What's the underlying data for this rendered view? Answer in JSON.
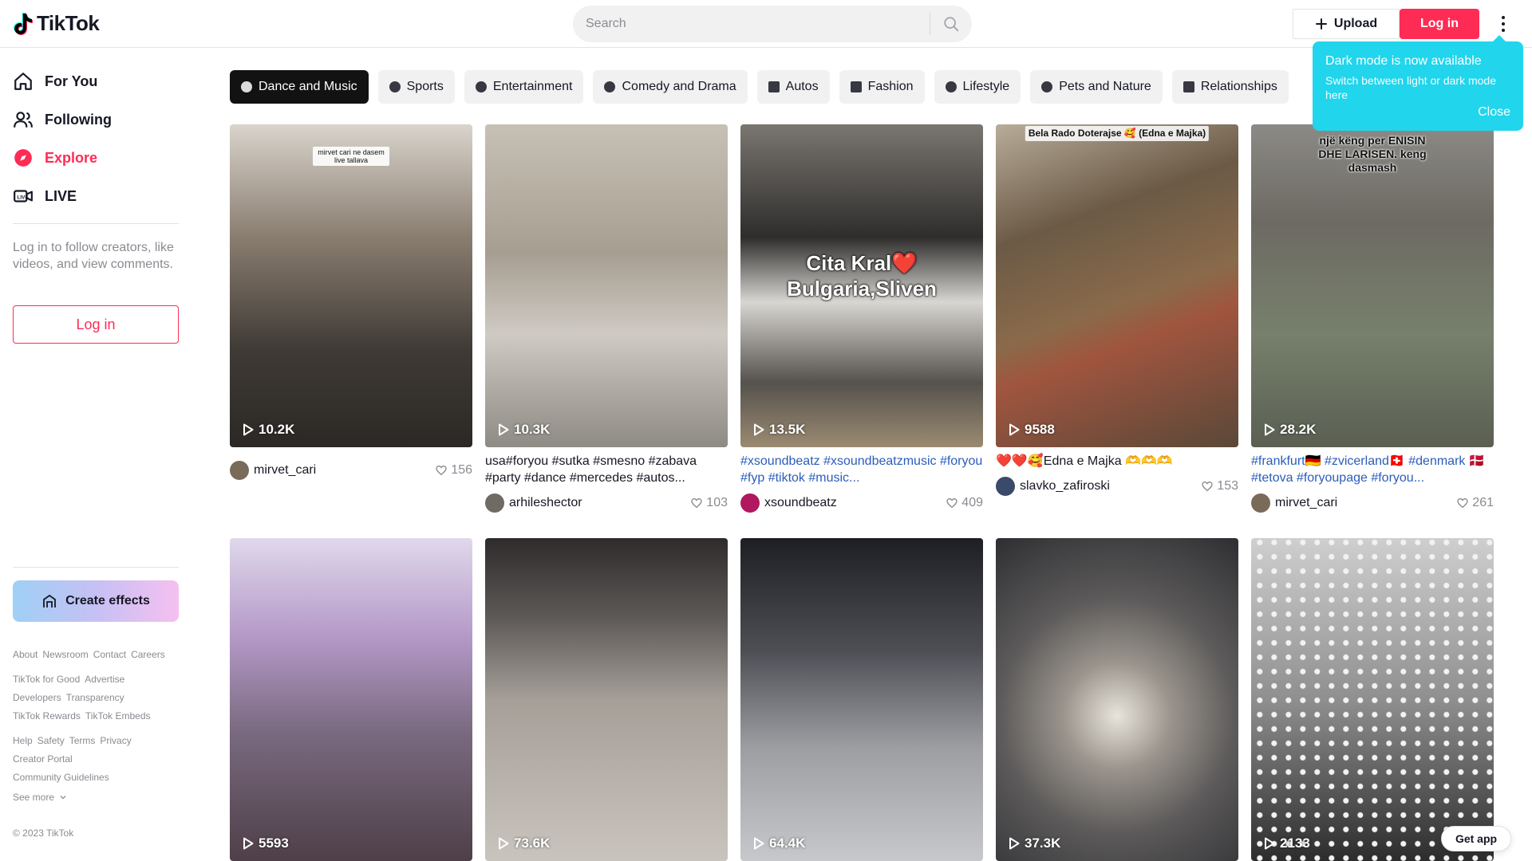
{
  "header": {
    "logo_text": "TikTok",
    "search_placeholder": "Search",
    "upload_label": "Upload",
    "login_label": "Log in"
  },
  "tooltip": {
    "title": "Dark mode is now available",
    "body": "Switch between light or dark mode here",
    "close_label": "Close"
  },
  "sidebar": {
    "nav": [
      {
        "label": "For You",
        "icon": "home-icon"
      },
      {
        "label": "Following",
        "icon": "users-icon"
      },
      {
        "label": "Explore",
        "icon": "compass-icon",
        "active": true
      },
      {
        "label": "LIVE",
        "icon": "live-camera-icon"
      }
    ],
    "login_hint": "Log in to follow creators, like videos, and view comments.",
    "login_button": "Log in",
    "create_effects": "Create effects",
    "footer_rows": [
      [
        "About",
        "Newsroom",
        "Contact",
        "Careers"
      ],
      [
        "TikTok for Good",
        "Advertise"
      ],
      [
        "Developers",
        "Transparency"
      ],
      [
        "TikTok Rewards",
        "TikTok Embeds"
      ],
      [
        "Help",
        "Safety",
        "Terms",
        "Privacy"
      ],
      [
        "Creator Portal"
      ],
      [
        "Community Guidelines"
      ]
    ],
    "see_more": "See more",
    "copyright": "© 2023 TikTok"
  },
  "categories": [
    {
      "label": "Dance and Music",
      "icon": "microphone-icon",
      "active": true
    },
    {
      "label": "Sports",
      "icon": "ball-icon"
    },
    {
      "label": "Entertainment",
      "icon": "sparkle-icon"
    },
    {
      "label": "Comedy and Drama",
      "icon": "smile-icon"
    },
    {
      "label": "Autos",
      "icon": "car-icon"
    },
    {
      "label": "Fashion",
      "icon": "bag-icon"
    },
    {
      "label": "Lifestyle",
      "icon": "cup-icon"
    },
    {
      "label": "Pets and Nature",
      "icon": "leaf-icon"
    },
    {
      "label": "Relationships",
      "icon": "heart-house-icon"
    }
  ],
  "videos": [
    {
      "views": "10.2K",
      "description": "",
      "user": "mirvet_cari",
      "likes": "156",
      "overlay": "mirvet cari ne dasem live tallava",
      "bg": "#5a5248"
    },
    {
      "views": "10.3K",
      "description": "usa#foryou #sutka #smesno #zabava #party #dance #mercedes #autos...",
      "user": "arhileshector",
      "likes": "103",
      "overlay": "",
      "bg": "#a9a197"
    },
    {
      "views": "13.5K",
      "description": "#xsoundbeatz #xsoundbeatzmusic #foryou #fyp #tiktok #music...",
      "user": "xsoundbeatz",
      "likes": "409",
      "overlay": "Cita Kral❤️ Bulgaria,Sliven",
      "bg": "#4b4a48"
    },
    {
      "views": "9588",
      "description": "❤️❤️🥰Edna e Majka 🫶🫶🫶",
      "user": "slavko_zafiroski",
      "likes": "153",
      "overlay": "Bela Rado Doterajse 🥰 (Edna e Majka)",
      "bg": "#6b5a46"
    },
    {
      "views": "28.2K",
      "description": "#frankfurt🇩🇪 #zvicerland🇨🇭 #denmark 🇩🇰 #tetova #foryoupage #foryou...",
      "user": "mirvet_cari",
      "likes": "261",
      "overlay": "një këng per ENISIN DHE LARISEN. keng dasmash",
      "bg": "#6d6a63"
    },
    {
      "views": "5593",
      "description": "",
      "user": "",
      "likes": "",
      "overlay": "",
      "bg": "#8e7aa4"
    },
    {
      "views": "73.6K",
      "description": "",
      "user": "",
      "likes": "",
      "overlay": "",
      "bg": "#8d8780"
    },
    {
      "views": "64.4K",
      "description": "",
      "user": "",
      "likes": "",
      "overlay": "",
      "bg": "#4e4f55"
    },
    {
      "views": "37.3K",
      "description": "",
      "user": "",
      "likes": "",
      "overlay": "",
      "bg": "#6c6a69"
    },
    {
      "views": "2133",
      "description": "",
      "user": "",
      "likes": "",
      "overlay": "",
      "bg": "#9a9896"
    }
  ],
  "get_app": "Get app",
  "colors": {
    "brand": "#fe2c55",
    "tooltip": "#20d5ec",
    "hashtag": "#2b5db9",
    "muted": "#8a8b91"
  }
}
